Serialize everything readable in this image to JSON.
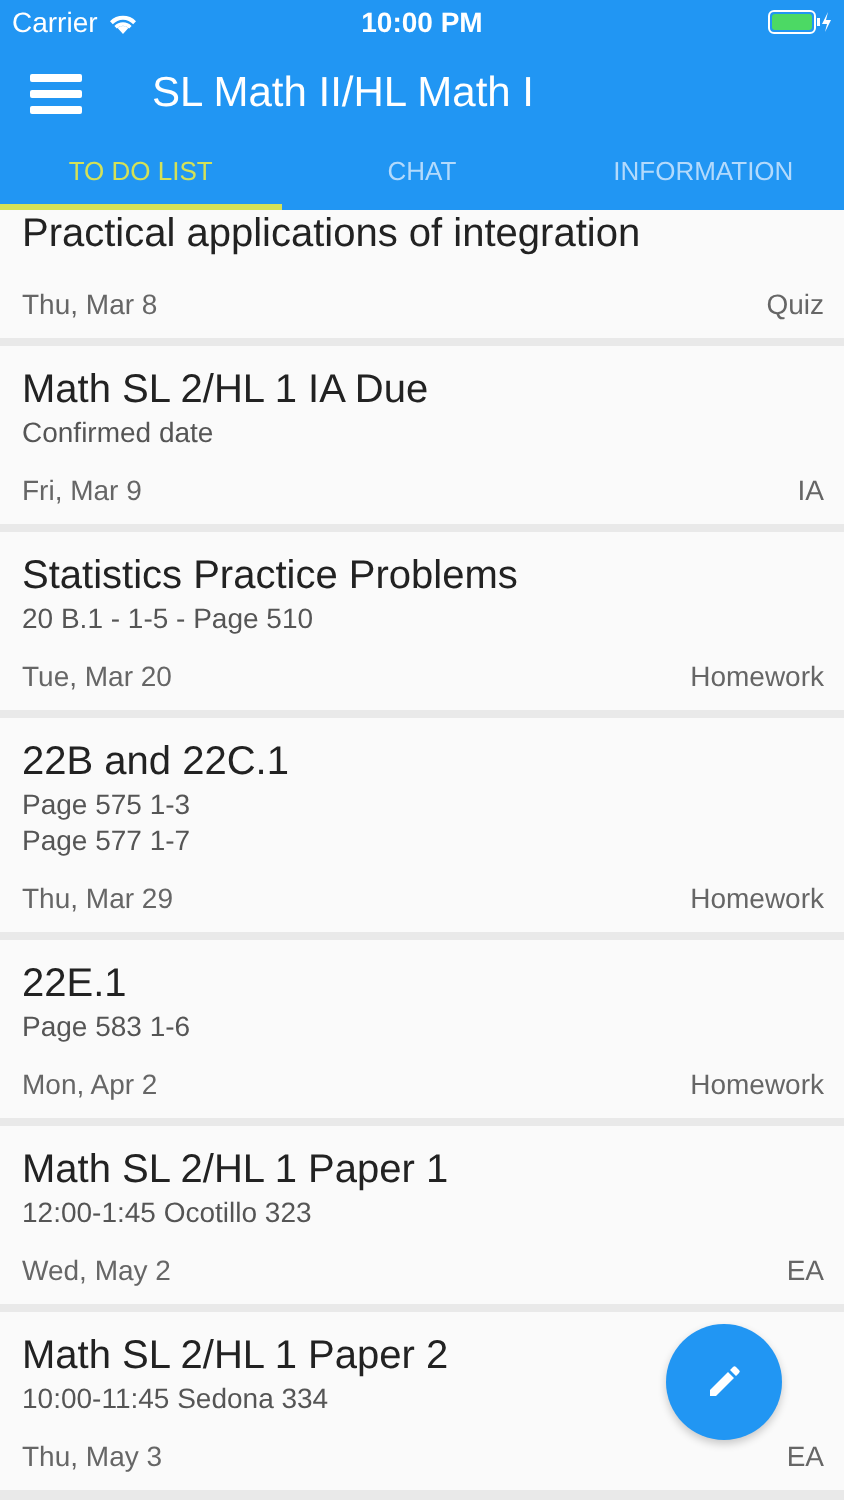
{
  "status_bar": {
    "carrier": "Carrier",
    "time": "10:00 PM"
  },
  "header": {
    "title": "SL Math II/HL Math I"
  },
  "tabs": [
    {
      "label": "TO DO LIST",
      "selected": true
    },
    {
      "label": "CHAT",
      "selected": false
    },
    {
      "label": "INFORMATION",
      "selected": false
    }
  ],
  "items": [
    {
      "title": "Practical applications of integration",
      "date": "Thu, Mar 8",
      "type": "Quiz"
    },
    {
      "title": "Math SL 2/HL 1 IA Due",
      "details": [
        "Confirmed date"
      ],
      "date": "Fri, Mar 9",
      "type": "IA"
    },
    {
      "title": "Statistics Practice Problems",
      "details": [
        "20 B.1 - 1-5 - Page 510"
      ],
      "date": "Tue, Mar 20",
      "type": "Homework"
    },
    {
      "title": "22B and 22C.1",
      "details": [
        "Page 575 1-3",
        "Page 577 1-7"
      ],
      "date": "Thu, Mar 29",
      "type": "Homework"
    },
    {
      "title": "22E.1",
      "details": [
        "Page 583 1-6"
      ],
      "date": "Mon, Apr 2",
      "type": "Homework"
    },
    {
      "title": "Math SL 2/HL 1 Paper 1",
      "details": [
        "12:00-1:45 Ocotillo 323"
      ],
      "date": "Wed, May 2",
      "type": "EA"
    },
    {
      "title": "Math SL 2/HL 1 Paper 2",
      "details": [
        "10:00-11:45 Sedona 334"
      ],
      "date": "Thu, May 3",
      "type": "EA"
    }
  ]
}
